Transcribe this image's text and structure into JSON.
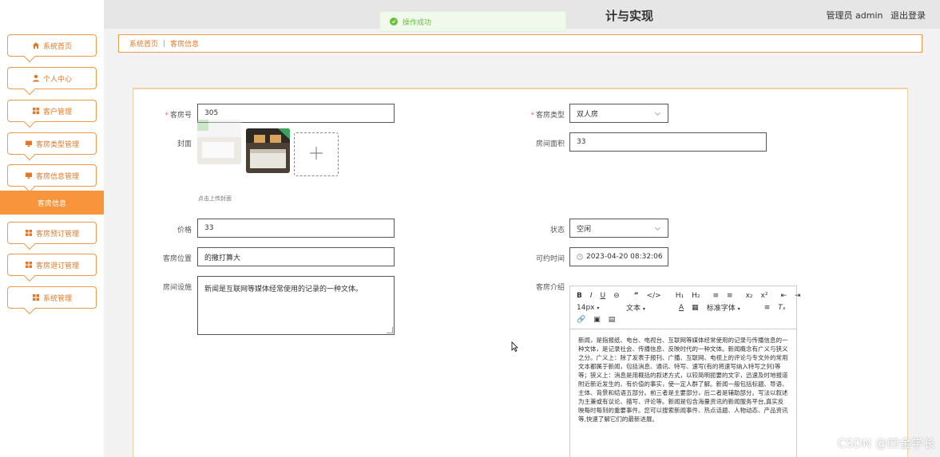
{
  "header": {
    "title": "计与实现",
    "user_label": "管理员 admin",
    "logout_label": "退出登录"
  },
  "toast": {
    "message": "操作成功"
  },
  "sidebar": {
    "items": [
      {
        "label": "系统首页",
        "icon": "home-icon"
      },
      {
        "label": "个人中心",
        "icon": "user-icon"
      },
      {
        "label": "客户管理",
        "icon": "grid-icon"
      },
      {
        "label": "客房类型管理",
        "icon": "monitor-icon"
      },
      {
        "label": "客房信息管理",
        "icon": "monitor-icon"
      },
      {
        "label": "客房预订管理",
        "icon": "grid-icon"
      },
      {
        "label": "客房退订管理",
        "icon": "grid-icon"
      },
      {
        "label": "系统管理",
        "icon": "grid-icon"
      }
    ],
    "active_sub": "客房信息"
  },
  "breadcrumb": {
    "home": "系统首页",
    "sep": "|",
    "current": "客房信息"
  },
  "form": {
    "room_no": {
      "label": "客房号",
      "value": "305"
    },
    "cover": {
      "label": "封面",
      "hint": "点击上传封面"
    },
    "price": {
      "label": "价格",
      "value": "33"
    },
    "location": {
      "label": "客房位置",
      "value": "的撒打算大"
    },
    "facilities": {
      "label": "房间设施",
      "value": "新闻是互联网等媒体经常使用的记录的一种文体。"
    },
    "room_type": {
      "label": "客房类型",
      "value": "双人房"
    },
    "area": {
      "label": "房间面积",
      "value": "33"
    },
    "status": {
      "label": "状态",
      "value": "空闲"
    },
    "available_time": {
      "label": "可约时间",
      "value": "2023-04-20 08:32:06"
    },
    "intro": {
      "label": "客房介绍",
      "font_size": "14px",
      "paragraph": "文本",
      "font_family": "标准字体",
      "content": "新闻，是指报纸、电台、电视台、互联网等媒体经常使用的记录与传播信息的一种文体，是记录社会、传播信息、反映时代的一种文体。新闻概念有广义与狭义之分。广义上：除了发表于报刊、广播、互联网、电视上的评论与专文外的常用文本都属于新闻，包括消息、通讯、特写、速写(有的将速写纳入特写之列)等等；狭义上：消息是用概括的叙述方式，以较简明扼要的文字，迅速及时地报道附近新近发生的、有价值的事实，使一定人群了解。新闻一般包括标题、导语、主体、背景和结语五部分。前三者是主要部分，后二者是辅助部分。写法以叙述为主兼或有议论、描写、评论等。新闻是包含海量资讯的新闻服务平台,真实反映每时每刻的重要事件。您可以搜索新闻事件、热点话题、人物动态、产品资讯等,快速了解它们的最新进展。"
    }
  },
  "watermark": "CSDN @四金学长"
}
